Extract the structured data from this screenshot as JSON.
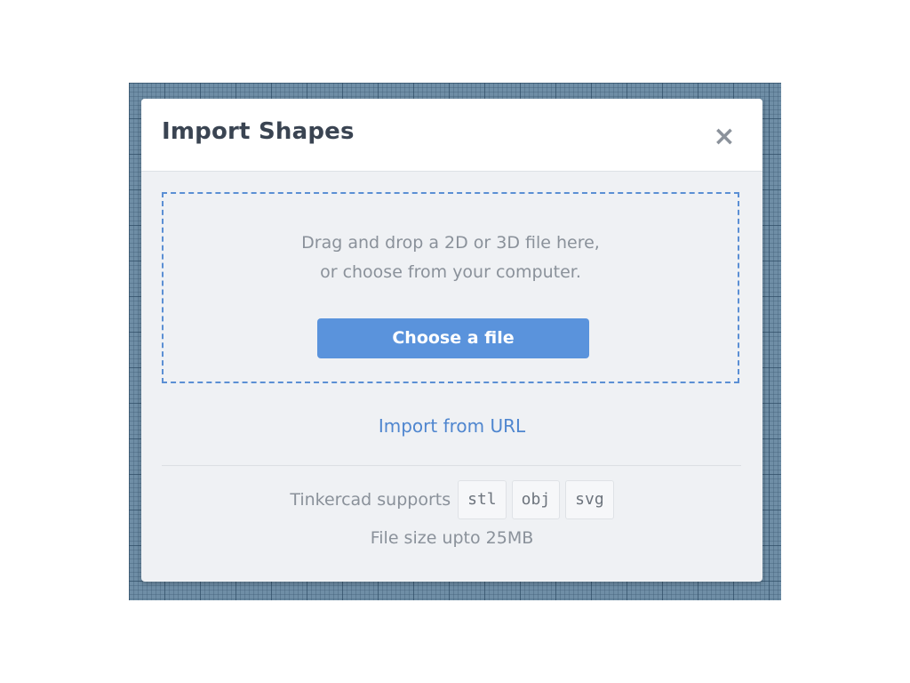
{
  "dialog": {
    "title": "Import Shapes",
    "close_icon": "close-icon",
    "close_glyph": "×"
  },
  "drop_zone": {
    "line1": "Drag and drop a 2D or 3D file here,",
    "line2": "or choose from your computer.",
    "choose_button_label": "Choose a file"
  },
  "import_url_label": "Import from URL",
  "supports": {
    "label": "Tinkercad supports",
    "formats": [
      "stl",
      "obj",
      "svg"
    ]
  },
  "size_note": "File size upto 25MB",
  "colors": {
    "accent": "#5a93dc",
    "link": "#4f86cf",
    "dialog_bg": "#eff1f4",
    "workplane_grid": "#6f8ea6"
  }
}
